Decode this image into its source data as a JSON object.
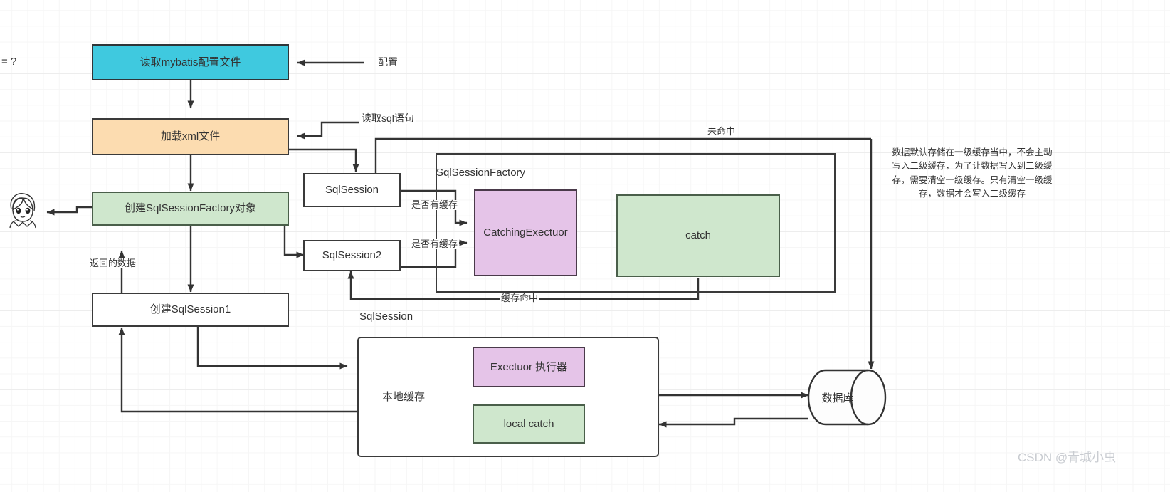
{
  "diagram": {
    "title_watermark": "CSDN @青城小虫",
    "corner_fragment": "= ?",
    "colors": {
      "cyan": "#3fc9df",
      "orange": "#fcdcb0",
      "green": "#cfe7cd",
      "purple": "#e5c4e8",
      "stroke": "#3a3a3a",
      "grid": "#ededed",
      "watermark": "#c9ccd1"
    },
    "nodes": [
      {
        "id": "read-config",
        "label": "读取mybatis配置文件"
      },
      {
        "id": "load-xml",
        "label": "加载xml文件"
      },
      {
        "id": "create-factory",
        "label": "创建SqlSessionFactory对象"
      },
      {
        "id": "create-session1",
        "label": "创建SqlSession1"
      },
      {
        "id": "sqlsession",
        "label": "SqlSession"
      },
      {
        "id": "sqlsession2",
        "label": "SqlSession2"
      },
      {
        "id": "catching-exectuor",
        "label": "CatchingExectuor"
      },
      {
        "id": "catch",
        "label": "catch"
      },
      {
        "id": "exectuor",
        "label": "Exectuor 执行器"
      },
      {
        "id": "local-catch",
        "label": "local  catch"
      },
      {
        "id": "database",
        "label": "数据库"
      }
    ],
    "groups": [
      {
        "id": "sqlsessionfactory-group",
        "label": "SqlSessionFactory"
      },
      {
        "id": "sqlsession-group",
        "label": "SqlSession"
      },
      {
        "id": "local-cache-label",
        "label": "本地缓存"
      }
    ],
    "edge_labels": [
      {
        "id": "config",
        "text": "配置"
      },
      {
        "id": "read-sql",
        "text": "读取sql语句"
      },
      {
        "id": "return-data",
        "text": "返回的数据"
      },
      {
        "id": "has-cache-1",
        "text": "是否有缓存"
      },
      {
        "id": "has-cache-2",
        "text": "是否有缓存"
      },
      {
        "id": "cache-hit",
        "text": "缓存命中"
      },
      {
        "id": "cache-miss",
        "text": "未命中"
      }
    ],
    "note": {
      "id": "second-level-cache-note",
      "text": "数据默认存储在一级缓存当中，不会主动\n写入二级缓存，为了让数据写入到二级缓\n存，需要清空一级缓存。只有清空一级缓\n存，数据才会写入二级缓存"
    }
  }
}
